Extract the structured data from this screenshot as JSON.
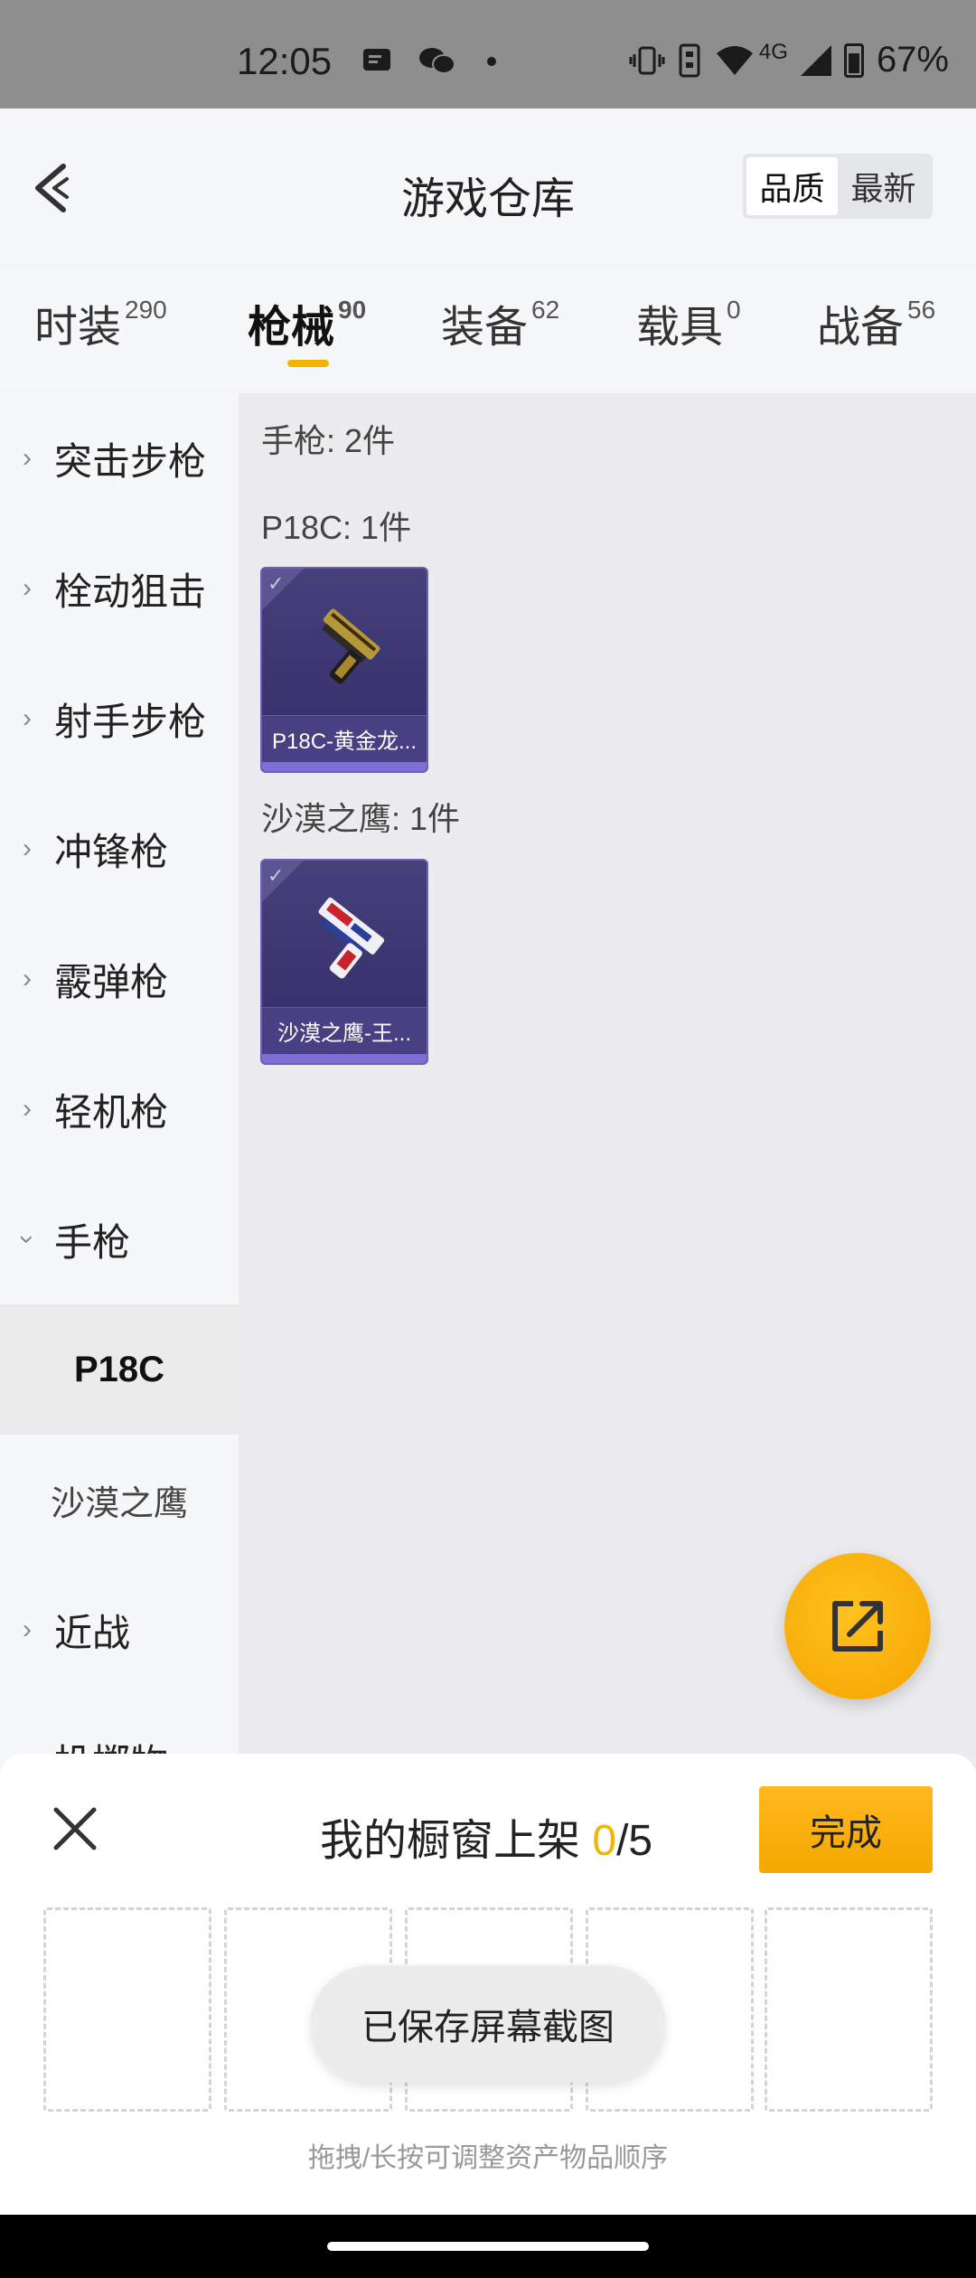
{
  "status_bar": {
    "time": "12:05",
    "network": "4G",
    "battery": "67%",
    "icons": [
      "message-icon",
      "wechat-icon",
      "dot-icon",
      "vibrate-icon",
      "sim-icon",
      "wifi-icon",
      "signal-icon",
      "battery-icon"
    ]
  },
  "header": {
    "title": "游戏仓库",
    "sort_options": [
      "品质",
      "最新"
    ],
    "active_sort": "品质"
  },
  "tabs": [
    {
      "label": "时装",
      "count": "290"
    },
    {
      "label": "枪械",
      "count": "90",
      "active": true
    },
    {
      "label": "装备",
      "count": "62"
    },
    {
      "label": "载具",
      "count": "0"
    },
    {
      "label": "战备",
      "count": "56"
    }
  ],
  "sidebar": {
    "items": [
      {
        "label": "突击步枪"
      },
      {
        "label": "栓动狙击"
      },
      {
        "label": "射手步枪"
      },
      {
        "label": "冲锋枪"
      },
      {
        "label": "霰弹枪"
      },
      {
        "label": "轻机枪"
      },
      {
        "label": "手枪",
        "expanded": true
      },
      {
        "label": "P18C",
        "sub": true,
        "selected": true
      },
      {
        "label": "沙漠之鹰",
        "sub": true
      },
      {
        "label": "近战"
      },
      {
        "label": "投掷物"
      }
    ]
  },
  "content": {
    "category_label": "手枪: 2件",
    "groups": [
      {
        "label": "P18C: 1件",
        "items": [
          {
            "name": "P18C-黄金龙..."
          }
        ]
      },
      {
        "label": "沙漠之鹰: 1件",
        "items": [
          {
            "name": "沙漠之鹰-王..."
          }
        ]
      }
    ]
  },
  "bottom_panel": {
    "title": "我的橱窗上架",
    "count_current": "0",
    "count_total": "/5",
    "done_label": "完成",
    "slots": 5,
    "hint": "拖拽/长按可调整资产物品顺序"
  },
  "toast": {
    "text": "已保存屏幕截图"
  },
  "colors": {
    "accent": "#f5b400",
    "card_bg": "#3a3470",
    "card_border": "#6b61b8"
  }
}
